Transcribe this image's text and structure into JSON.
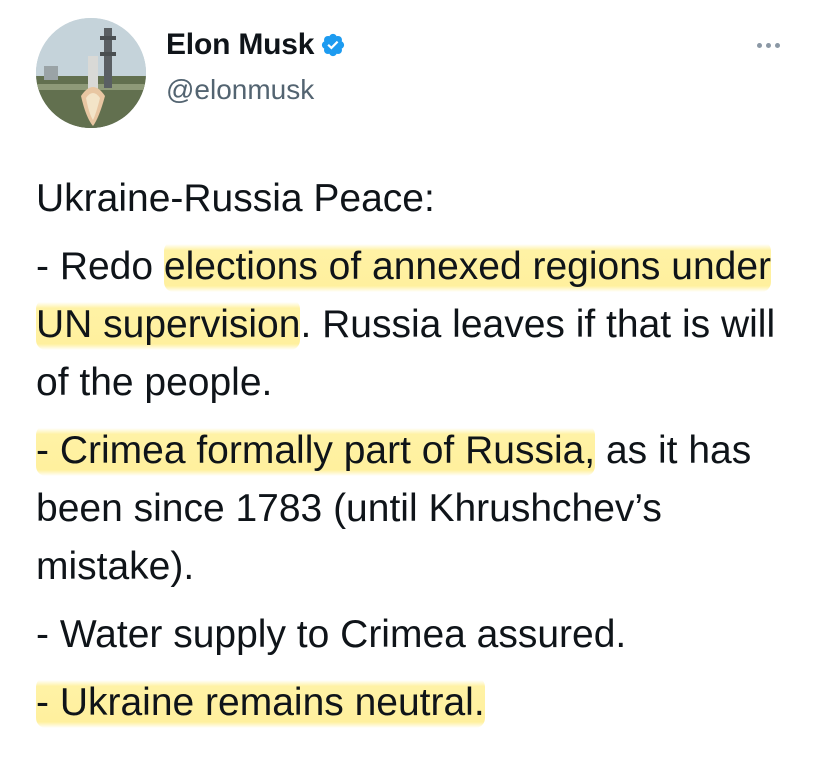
{
  "author": {
    "display_name": "Elon Musk",
    "handle": "@elonmusk",
    "verified_icon": "verified-badge-icon",
    "more_icon": "more-icon",
    "badge_color": "#1d9bf0"
  },
  "tweet": {
    "title": "Ukraine-Russia Peace:",
    "p1": {
      "prefix": "- Redo ",
      "highlight": "elections of annexed regions under UN supervision",
      "suffix": ". Russia leaves if that is will of the people."
    },
    "p2": {
      "highlight": "- Crimea formally part of Russia,",
      "suffix": " as it has been since 1783 (until Khrushchev’s mistake)."
    },
    "p3": {
      "text": "- Water supply to Crimea assured."
    },
    "p4": {
      "highlight": "- Ukraine remains neutral."
    }
  },
  "colors": {
    "highlight": "#fff08c",
    "text": "#0f1419",
    "secondary": "#536471"
  }
}
